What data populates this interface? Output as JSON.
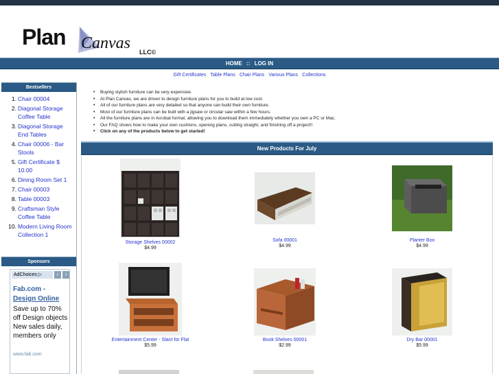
{
  "brand": {
    "word": "Plan",
    "script": "Canvas",
    "suffix": "LLC©"
  },
  "nav": {
    "home": "HOME",
    "sep": "::",
    "login": "LOG IN"
  },
  "categories": [
    "Gift Certificates",
    "Table Plans",
    "Chair Plans",
    "Various Plans",
    "Collections"
  ],
  "sidebar": {
    "bestsellers_title": "Bestsellers",
    "bestsellers": [
      {
        "num": "1.",
        "label": "Chair 00004"
      },
      {
        "num": "2.",
        "label": "Diagonal Storage Coffee Table"
      },
      {
        "num": "3.",
        "label": "Diagonal Storage End Tables"
      },
      {
        "num": "4.",
        "label": "Chair 00006 - Bar Stools"
      },
      {
        "num": "5.",
        "label": "Gift Certificate $ 10.00"
      },
      {
        "num": "6.",
        "label": "Dining Room Set 1"
      },
      {
        "num": "7.",
        "label": "Chair 00003"
      },
      {
        "num": "8.",
        "label": "Table 00003"
      },
      {
        "num": "9.",
        "label": "Craftsman Style Coffee Table"
      },
      {
        "num": "10.",
        "label": "Modern Living Room Collection 1"
      }
    ],
    "sponsors_title": "Sponsors"
  },
  "ad": {
    "choices": "AdChoices ▷",
    "prev": "‹",
    "next": "›",
    "title1": "Fab.com -",
    "title2": "Design Online",
    "body": "Save up to 70% off Design objects New sales daily, members only",
    "url": "www.fab.com"
  },
  "intro": [
    {
      "text": "Buying stylish furniture can be very expensive.",
      "bold": false
    },
    {
      "text": "At Plan Canvas, we are driven to design furniture plans for you to build at low cost.",
      "bold": false
    },
    {
      "text": "All of our furniture plans are very detailed so that anyone can build their own furniture.",
      "bold": false
    },
    {
      "text": "Most of our furniture plans can be built with a jigsaw or circular saw within a few hours.",
      "bold": false
    },
    {
      "text": "All the furniture plans are in Acrobat format, allowing you to download them immediately whether you own a PC or Mac.",
      "bold": false
    },
    {
      "text": "Our FAQ shows how to make your own cushions, opening plans, cutting straight, and finishing off a project!!",
      "bold": false
    },
    {
      "text": "Click on any of the products below to get started!",
      "bold": true
    }
  ],
  "new_products_title": "New Products For July",
  "products": [
    {
      "name": "Storage Shelves 00002",
      "price": "$4.99",
      "icon": "storage-shelves-image"
    },
    {
      "name": "Sofa 00001",
      "price": "$4.99",
      "icon": "sofa-image"
    },
    {
      "name": "Planter Box",
      "price": "$4.99",
      "icon": "planter-box-image"
    },
    {
      "name": "Entertainment Center - Slant for Flat",
      "price": "$5.99",
      "icon": "entertainment-center-image"
    },
    {
      "name": "Book Shelves 00001",
      "price": "$2.99",
      "icon": "book-shelves-image"
    },
    {
      "name": "Dry Bar 00001",
      "price": "$5.99",
      "icon": "dry-bar-image"
    }
  ]
}
